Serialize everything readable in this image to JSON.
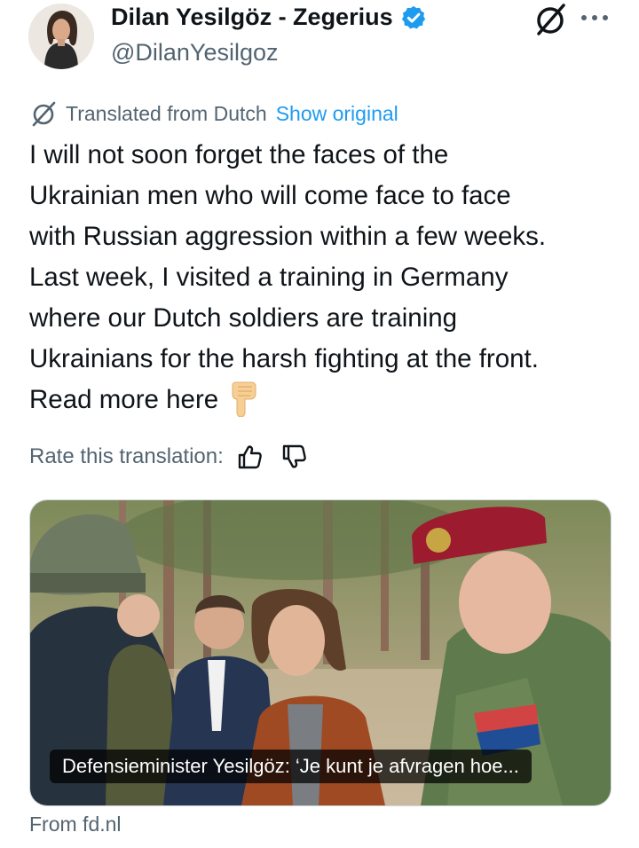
{
  "author": {
    "display_name": "Dilan Yesilgöz - Zegerius",
    "handle": "@DilanYesilgoz",
    "avatar_icon": "profile-photo",
    "verified_color": "#1d9bf0"
  },
  "header_icons": [
    "grok-icon",
    "more-icon"
  ],
  "translation": {
    "label": "Translated from Dutch",
    "link": "Show original"
  },
  "tweet": {
    "lines": [
      "I will not soon forget the faces of the",
      "Ukrainian men who will come face to face",
      "with Russian aggression within a few weeks.",
      "Last week, I visited a training in Germany",
      "where our Dutch soldiers are training",
      "Ukrainians for the harsh fighting at the front.",
      "Read more here"
    ],
    "emoji": "backhand-index-pointing-down"
  },
  "rating": {
    "label": "Rate this translation:"
  },
  "link_card": {
    "caption": "Defensieminister Yesilgöz: ‘Je kunt je afvragen hoe...",
    "source": "From fd.nl"
  },
  "colors": {
    "text": "#0f1419",
    "secondary": "#536471",
    "link": "#1d9bf0"
  }
}
